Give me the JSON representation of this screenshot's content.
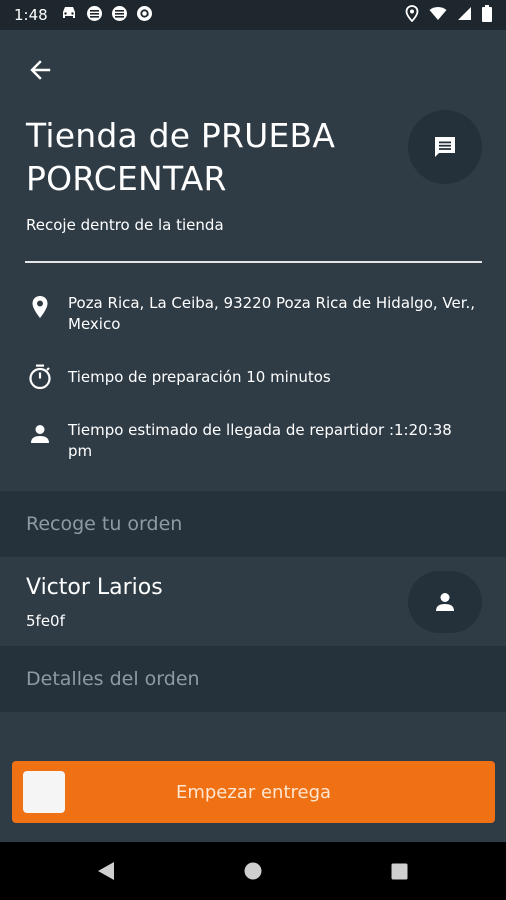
{
  "status_bar": {
    "time": "1:48",
    "icons_left": [
      "car-icon",
      "circle-icon",
      "circle-icon",
      "at-icon"
    ],
    "icons_right": [
      "location-icon",
      "wifi-icon",
      "signal-icon",
      "battery-icon"
    ]
  },
  "store": {
    "title": "Tienda de PRUEBA PORCENTAR",
    "pickup_type": "Recoje dentro de la tienda",
    "address": "Poza Rica, La Ceiba, 93220 Poza Rica de Hidalgo, Ver., Mexico",
    "prep_time": "Tiempo de preparación 10 minutos",
    "eta": "Tiempo estimado de llegada de repartidor :1:20:38 pm"
  },
  "sections": {
    "pickup_header": "Recoge tu orden",
    "details_header": "Detalles del orden"
  },
  "customer": {
    "name": "Victor Larios",
    "code": "5fe0f"
  },
  "actions": {
    "start_delivery": "Empezar entrega"
  },
  "colors": {
    "background": "#2f3c46",
    "section_header": "#26323b",
    "accent": "#f07113",
    "status_bar": "#1e272e"
  }
}
